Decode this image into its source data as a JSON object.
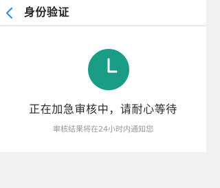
{
  "header": {
    "title": "身份验证",
    "back_icon": "chevron-left-icon"
  },
  "status": {
    "icon": "clock-icon",
    "title": "正在加急审核中，请耐心等待",
    "description": "审核结果将在24小时内通知您"
  },
  "colors": {
    "accent": "#1a9c86",
    "back_arrow": "#2d8ef0",
    "page_background": "#f1f1f2"
  }
}
